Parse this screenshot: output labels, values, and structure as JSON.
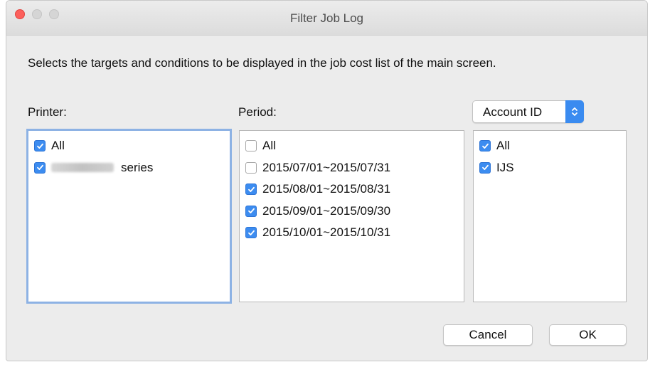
{
  "window": {
    "title": "Filter Job Log"
  },
  "description": "Selects the targets and conditions to be displayed in the job cost list of the main screen.",
  "printer": {
    "label": "Printer:",
    "items": [
      {
        "label": "All",
        "checked": true
      },
      {
        "label": "series",
        "checked": true
      }
    ]
  },
  "period": {
    "label": "Period:",
    "items": [
      {
        "label": "All",
        "checked": false
      },
      {
        "label": "2015/07/01~2015/07/31",
        "checked": false
      },
      {
        "label": "2015/08/01~2015/08/31",
        "checked": true
      },
      {
        "label": "2015/09/01~2015/09/30",
        "checked": true
      },
      {
        "label": "2015/10/01~2015/10/31",
        "checked": true
      }
    ]
  },
  "account": {
    "select_value": "Account ID",
    "items": [
      {
        "label": "All",
        "checked": true
      },
      {
        "label": "IJS",
        "checked": true
      }
    ]
  },
  "buttons": {
    "cancel": "Cancel",
    "ok": "OK"
  },
  "colors": {
    "accent": "#3a8bf0",
    "close": "#fc605c",
    "focus_ring": "#8db2e4"
  }
}
